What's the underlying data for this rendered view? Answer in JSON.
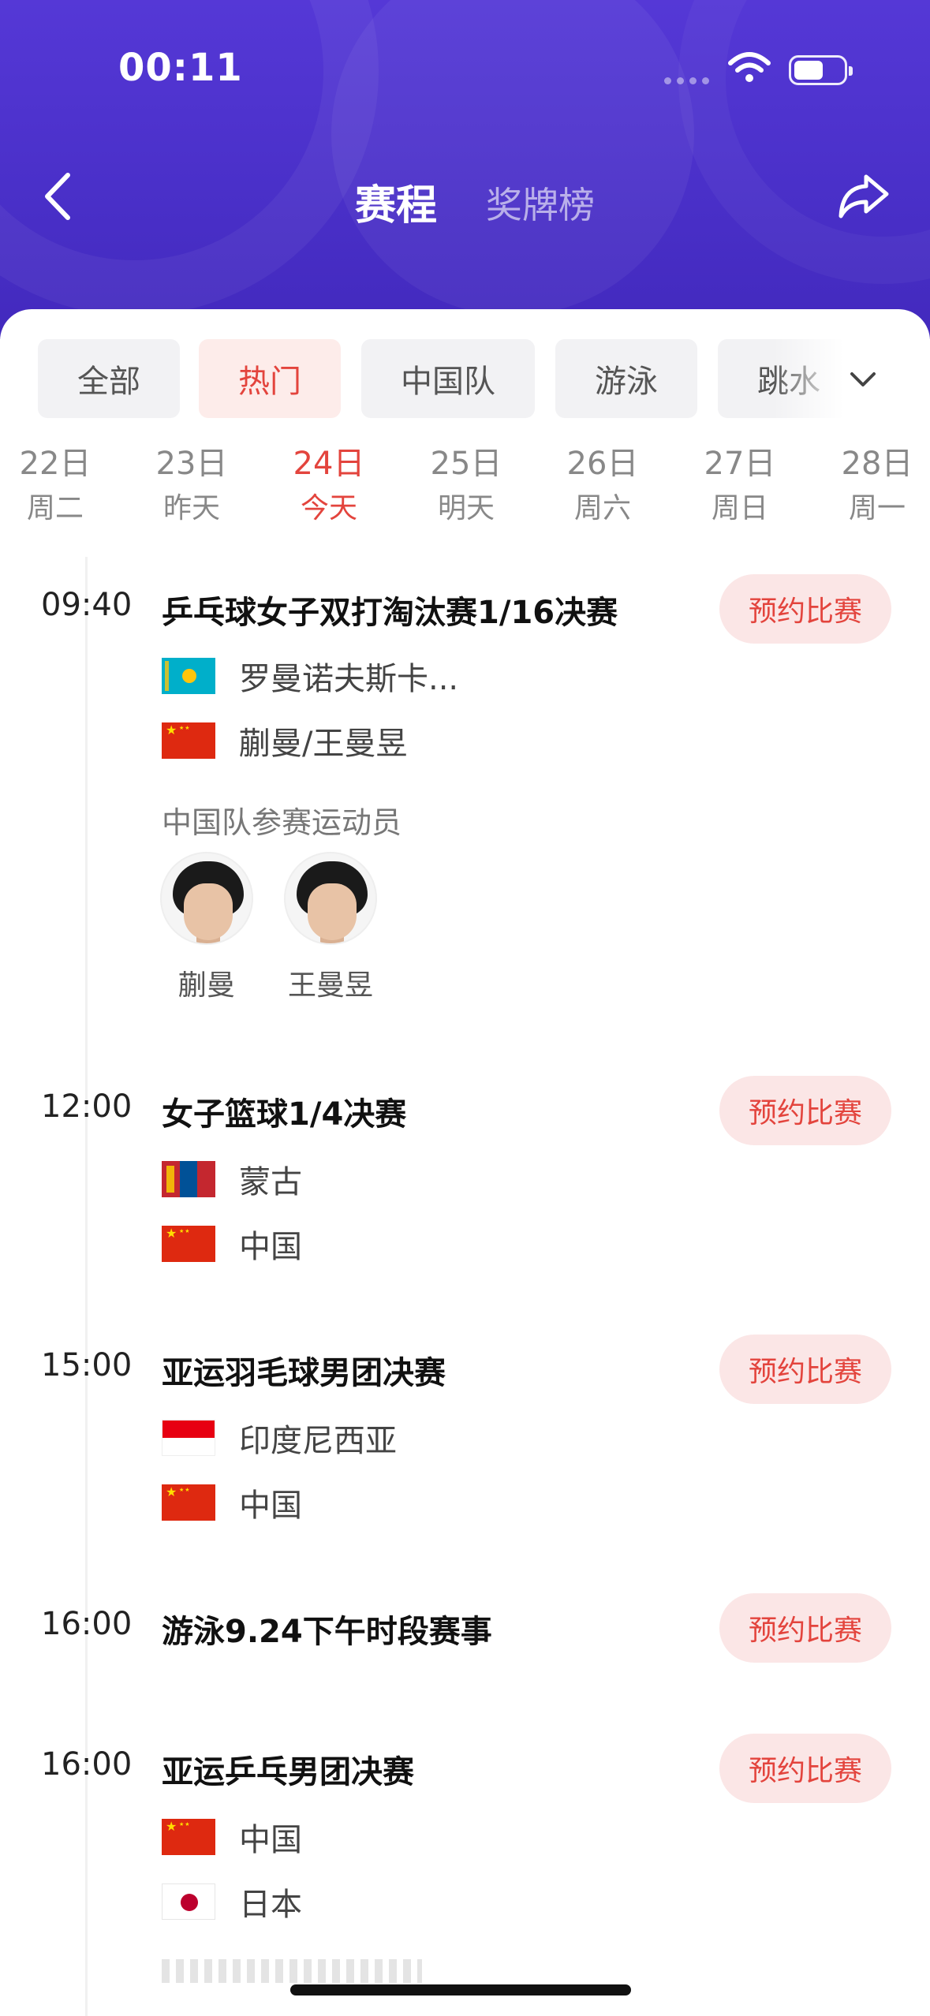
{
  "status_bar": {
    "time": "00:11"
  },
  "header": {
    "tabs": [
      {
        "label": "赛程",
        "active": true
      },
      {
        "label": "奖牌榜",
        "active": false
      }
    ],
    "brand_color": "#4a30c9"
  },
  "filters": {
    "chips": [
      {
        "label": "全部",
        "active": false
      },
      {
        "label": "热门",
        "active": true
      },
      {
        "label": "中国队",
        "active": false
      },
      {
        "label": "游泳",
        "active": false
      },
      {
        "label": "跳水",
        "active": false
      }
    ],
    "accent_color": "#e3443d"
  },
  "dates": [
    {
      "day": "22日",
      "weekday": "周二"
    },
    {
      "day": "23日",
      "weekday": "昨天"
    },
    {
      "day": "24日",
      "weekday": "今天",
      "selected": true
    },
    {
      "day": "25日",
      "weekday": "明天"
    },
    {
      "day": "26日",
      "weekday": "周六"
    },
    {
      "day": "27日",
      "weekday": "周日"
    },
    {
      "day": "28日",
      "weekday": "周一"
    }
  ],
  "events": [
    {
      "time": "09:40",
      "title": "乒乓球女子双打淘汰赛1/16决赛",
      "button": "预约比赛",
      "teams": [
        {
          "flag": "kazakhstan-flag",
          "name": "罗曼诺夫斯卡..."
        },
        {
          "flag": "china-flag",
          "name": "蒯曼/王曼昱"
        }
      ],
      "athletes_label": "中国队参赛运动员",
      "athletes": [
        {
          "name": "蒯曼"
        },
        {
          "name": "王曼昱"
        }
      ]
    },
    {
      "time": "12:00",
      "title": "女子篮球1/4决赛",
      "button": "预约比赛",
      "teams": [
        {
          "flag": "mongolia-flag",
          "name": "蒙古"
        },
        {
          "flag": "china-flag",
          "name": "中国"
        }
      ]
    },
    {
      "time": "15:00",
      "title": "亚运羽毛球男团决赛",
      "button": "预约比赛",
      "teams": [
        {
          "flag": "indonesia-flag",
          "name": "印度尼西亚"
        },
        {
          "flag": "china-flag",
          "name": "中国"
        }
      ]
    },
    {
      "time": "16:00",
      "title": "游泳9.24下午时段赛事",
      "button": "预约比赛",
      "teams": []
    },
    {
      "time": "16:00",
      "title": "亚运乒乓男团决赛",
      "button": "预约比赛",
      "teams": [
        {
          "flag": "china-flag",
          "name": "中国"
        },
        {
          "flag": "japan-flag",
          "name": "日本"
        }
      ]
    }
  ]
}
